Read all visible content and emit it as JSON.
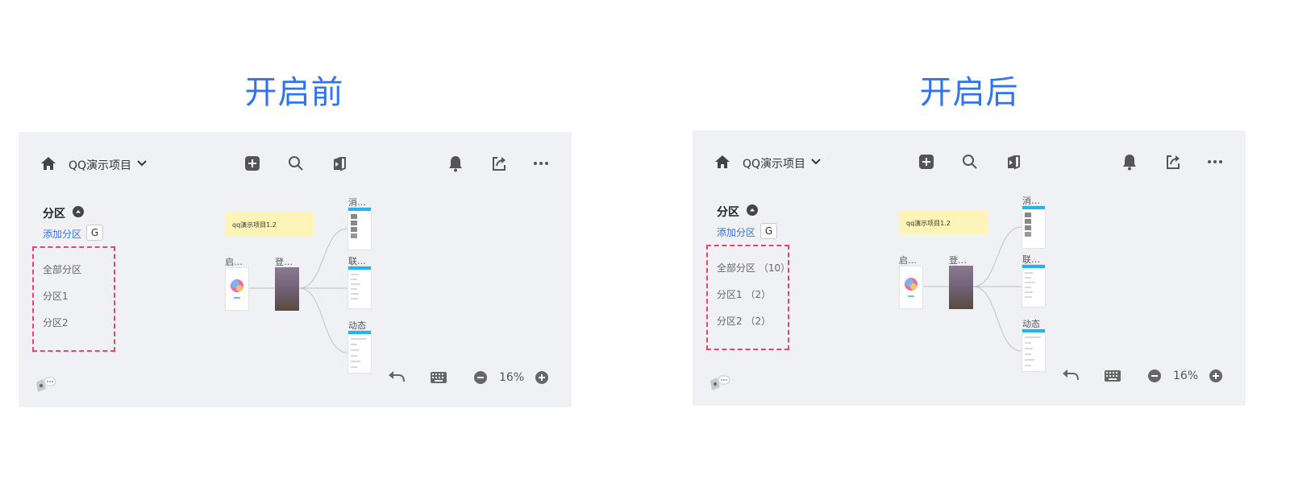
{
  "headings": {
    "before": "开启前",
    "after": "开启后"
  },
  "panels": [
    {
      "project_name": "QQ演示项目",
      "section_title": "分区",
      "add_partition": "添加分区",
      "shortcut": "G",
      "partitions": [
        "全部分区",
        "分区1",
        "分区2"
      ],
      "sticky_note": "qq演示项目1.2",
      "nodes": {
        "launch": "启…",
        "login": "登…",
        "messages": "消…",
        "contacts": "联…",
        "feed": "动态"
      },
      "zoom": "16%"
    },
    {
      "project_name": "QQ演示项目",
      "section_title": "分区",
      "add_partition": "添加分区",
      "shortcut": "G",
      "partitions": [
        "全部分区 （10）",
        "分区1 （2）",
        "分区2 （2）"
      ],
      "sticky_note": "qq演示项目1.2",
      "nodes": {
        "launch": "启…",
        "login": "登…",
        "messages": "消…",
        "contacts": "联…",
        "feed": "动态"
      },
      "zoom": "16%"
    }
  ],
  "colors": {
    "accent": "#2f74ee",
    "highlight": "#ee4266",
    "panel_bg": "#f0f1f5",
    "sticky": "#fdf5b8"
  },
  "icons": [
    "home-icon",
    "chevron-down-icon",
    "add-icon",
    "search-icon",
    "flag-icon",
    "bell-icon",
    "share-icon",
    "more-icon",
    "collapse-icon",
    "undo-icon",
    "keyboard-icon",
    "zoom-out-icon",
    "zoom-in-icon",
    "chat-icon"
  ]
}
